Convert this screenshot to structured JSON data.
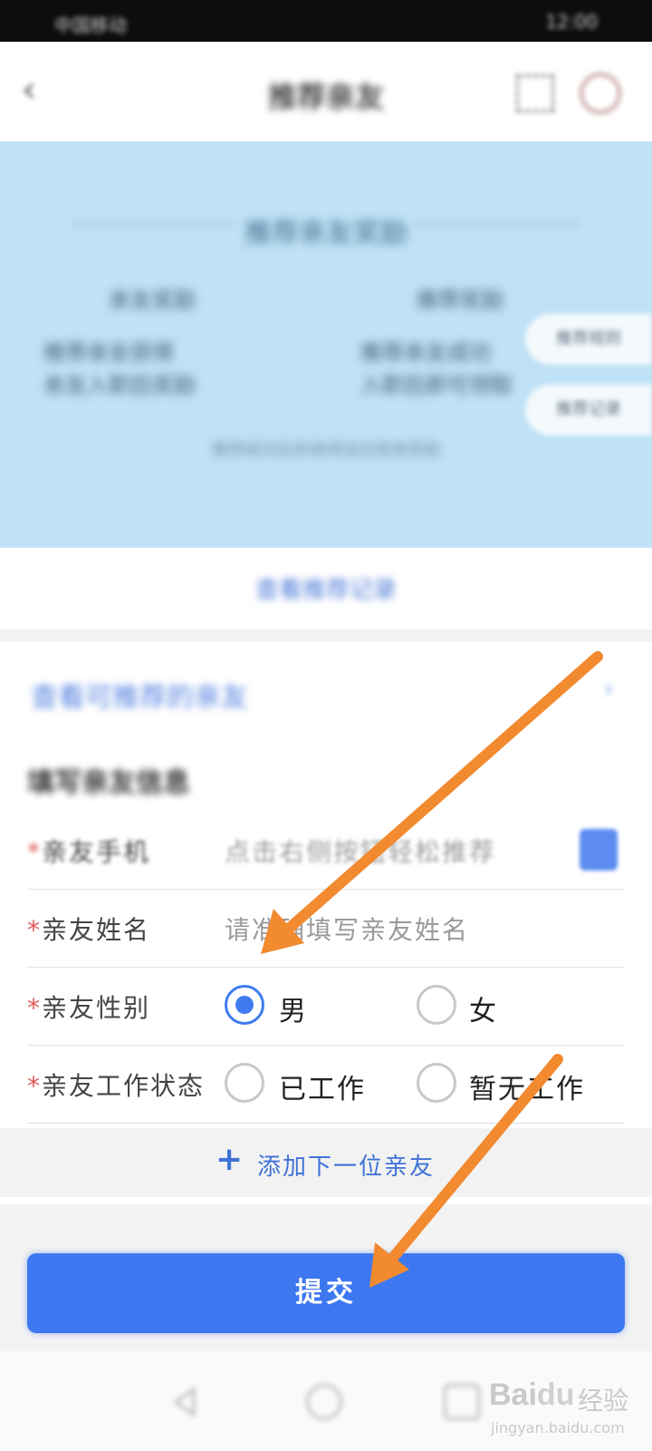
{
  "status_bar": {
    "left_text": "中国移动",
    "right_text": "12:00"
  },
  "nav": {
    "title": "推荐亲友"
  },
  "banner": {
    "heading": "推荐亲友奖励",
    "left_title": "亲友奖励",
    "right_title": "推荐奖励",
    "left_desc": [
      "推荐亲友获得",
      "亲友入职后奖励"
    ],
    "right_desc": [
      "推荐亲友成功",
      "入职后即可领取"
    ],
    "note": "推荐成功后系统将自动发放奖励",
    "pill_top": "推荐规则",
    "pill_bottom": "推荐记录"
  },
  "link": {
    "text": "查看推荐记录"
  },
  "recommend_row": {
    "text": "查看可推荐的亲友",
    "chevron": "›"
  },
  "section_title": "填写亲友信息",
  "form": {
    "phone": {
      "star": "*",
      "label": "亲友手机",
      "placeholder": "点击右侧按钮轻松推荐"
    },
    "name": {
      "star": "*",
      "label": "亲友姓名",
      "placeholder": "请准确填写亲友姓名"
    },
    "gender": {
      "star": "*",
      "label": "亲友性别",
      "options": [
        "男",
        "女"
      ],
      "selected": "男"
    },
    "work": {
      "star": "*",
      "label": "亲友工作状态",
      "options": [
        "已工作",
        "暂无工作"
      ],
      "selected": ""
    }
  },
  "add_more": {
    "plus": "+",
    "text": "添加下一位亲友"
  },
  "submit": {
    "label": "提交"
  },
  "watermark": {
    "brand_a": "Bai",
    "brand_paw": "du",
    "cn": "经验",
    "url": "jingyan.baidu.com"
  },
  "colors": {
    "primary": "#3d78f1",
    "annotation_arrow": "#f28a30",
    "banner_bg": "#bfe2f6",
    "required_star": "#e05a5a"
  }
}
